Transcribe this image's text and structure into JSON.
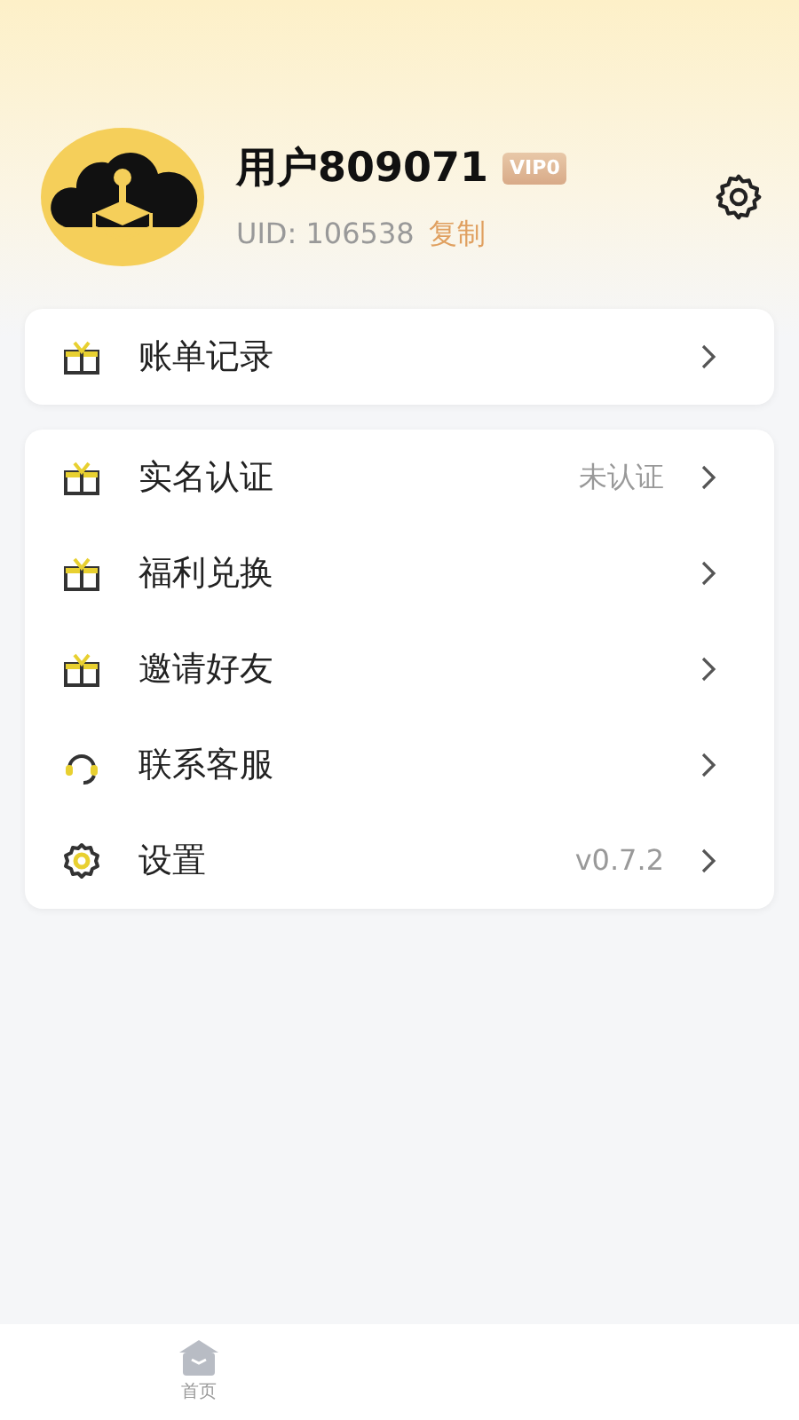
{
  "profile": {
    "username": "用户809071",
    "vip_badge": "VIP0",
    "uid_label": "UID:",
    "uid": "106538",
    "copy_link": "复制"
  },
  "menu_groups": [
    {
      "items": [
        {
          "kind": "gift",
          "label": "账单记录"
        }
      ]
    },
    {
      "items": [
        {
          "kind": "gift",
          "label": "实名认证",
          "value": "未认证"
        },
        {
          "kind": "gift",
          "label": "福利兑换"
        },
        {
          "kind": "gift",
          "label": "邀请好友"
        },
        {
          "kind": "headset",
          "label": "联系客服"
        },
        {
          "kind": "gear",
          "label": "设置",
          "value": "v0.7.2"
        }
      ]
    }
  ],
  "tab_bar": [
    {
      "label": "首页",
      "selected": false
    }
  ]
}
